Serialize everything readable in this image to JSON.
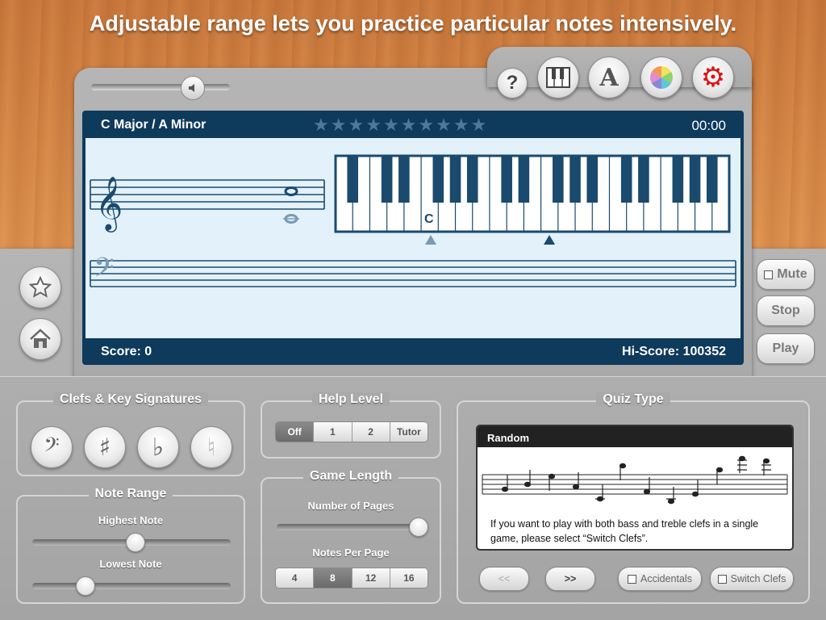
{
  "headline": "Adjustable range lets you practice particular notes intensively.",
  "toolbar": {
    "volume_icon": "speaker-icon",
    "help_label": "?",
    "piano_icon": "piano-keys-icon",
    "font_label": "A",
    "color_icon": "color-wheel-icon",
    "settings_icon": "gear-icon"
  },
  "screen": {
    "key": "C Major  /  A Minor",
    "stars_total": 10,
    "stars_filled": 0,
    "timer": "00:00",
    "score": "Score: 0",
    "hiscore": "Hi-Score: 100352",
    "note_label": "C"
  },
  "side": {
    "favorite_icon": "star-icon",
    "home_icon": "home-icon",
    "mute_label": "Mute",
    "stop_label": "Stop",
    "play_label": "Play"
  },
  "clefs": {
    "title": "Clefs & Key Signatures",
    "buttons": [
      "bass-clef",
      "sharp",
      "flat",
      "natural"
    ]
  },
  "note_range": {
    "title": "Note Range",
    "highest_label": "Highest Note",
    "lowest_label": "Lowest Note",
    "highest_value": 0.52,
    "lowest_value": 0.27
  },
  "help_level": {
    "title": "Help Level",
    "options": [
      "Off",
      "1",
      "2",
      "Tutor"
    ],
    "selected": "Off"
  },
  "game_length": {
    "title": "Game Length",
    "pages_label": "Number of Pages",
    "pages_value": 1.0,
    "notes_label": "Notes Per Page",
    "notes_options": [
      "4",
      "8",
      "12",
      "16"
    ],
    "notes_selected": "8"
  },
  "quiz": {
    "title": "Quiz Type",
    "card_title": "Random",
    "description": "If you want to play with both bass and treble clefs in a single game, please select “Switch Clefs”.",
    "prev_label": "<<",
    "next_label": ">>",
    "accidentals_label": "Accidentals",
    "switch_clefs_label": "Switch Clefs"
  },
  "colors": {
    "screen_bg": "#0e3a5c",
    "screen_body": "#e3f1fb",
    "gear": "#e01010",
    "staff": "#1a4a6e"
  }
}
